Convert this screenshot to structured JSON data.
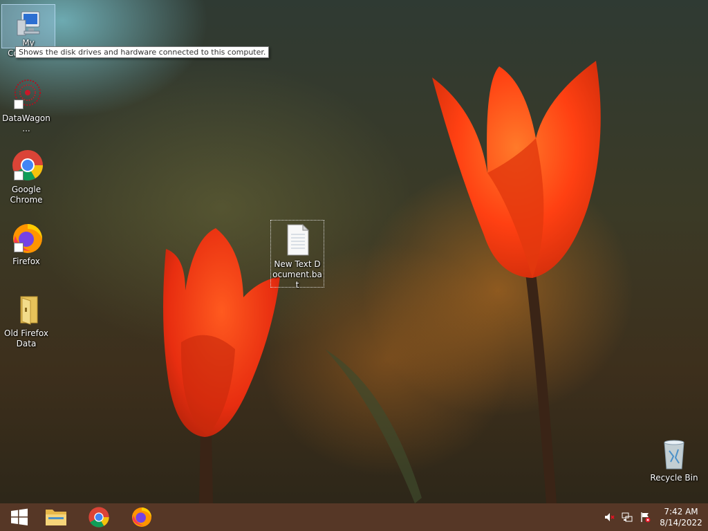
{
  "desktop": {
    "icons": [
      {
        "label": "My Computer"
      },
      {
        "label": "DataWagon..."
      },
      {
        "label": "Google Chrome"
      },
      {
        "label": "Firefox"
      },
      {
        "label": "Old Firefox Data"
      },
      {
        "label": "New Text Document.bat"
      },
      {
        "label": "Recycle Bin"
      }
    ],
    "tooltip": "Shows the disk drives and hardware connected to this computer."
  },
  "taskbar": {
    "buttons": [
      "windows-start-icon",
      "file-explorer-icon",
      "chrome-icon",
      "firefox-icon"
    ],
    "tray": {
      "icons": [
        "volume-muted-icon",
        "network-icon",
        "action-center-flag-icon"
      ],
      "time": "7:42 AM",
      "date": "8/14/2022"
    }
  },
  "colors": {
    "taskbar": "#5c3a28",
    "tulip": "#ff4a14"
  }
}
